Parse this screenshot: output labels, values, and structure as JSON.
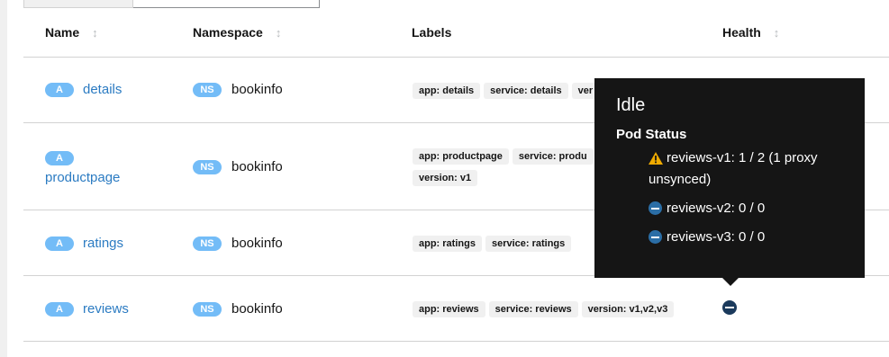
{
  "columns": [
    {
      "label": "Name",
      "sortable": true
    },
    {
      "label": "Namespace",
      "sortable": true
    },
    {
      "label": "Labels",
      "sortable": false
    },
    {
      "label": "Health",
      "sortable": true
    }
  ],
  "rows": [
    {
      "type_badge": "A",
      "name": "details",
      "ns_badge": "NS",
      "namespace": "bookinfo",
      "labels": [
        "app: details",
        "service: details",
        "ver"
      ]
    },
    {
      "type_badge": "A",
      "name": "productpage",
      "ns_badge": "NS",
      "namespace": "bookinfo",
      "labels": [
        "app: productpage",
        "service: produ",
        "version: v1"
      ]
    },
    {
      "type_badge": "A",
      "name": "ratings",
      "ns_badge": "NS",
      "namespace": "bookinfo",
      "labels": [
        "app: ratings",
        "service: ratings"
      ]
    },
    {
      "type_badge": "A",
      "name": "reviews",
      "ns_badge": "NS",
      "namespace": "bookinfo",
      "labels": [
        "app: reviews",
        "service: reviews",
        "version: v1,v2,v3"
      ],
      "health_icon": "minus-circle-icon"
    }
  ],
  "tooltip": {
    "title": "Idle",
    "subtitle": "Pod Status",
    "items": [
      {
        "icon": "warning-icon",
        "text_line1": "reviews-v1: 1 / 2 (1 proxy",
        "text_line2": "unsynced)"
      },
      {
        "icon": "minus-circle-icon",
        "text_line1": "reviews-v2: 0 / 0"
      },
      {
        "icon": "minus-circle-icon",
        "text_line1": "reviews-v3: 0 / 0"
      }
    ]
  },
  "colors": {
    "badge": "#73bcf7",
    "link": "#2b7bc2",
    "tooltip_bg": "#151515",
    "warning": "#f0ab00",
    "health_idle": "#1b3a5c"
  }
}
